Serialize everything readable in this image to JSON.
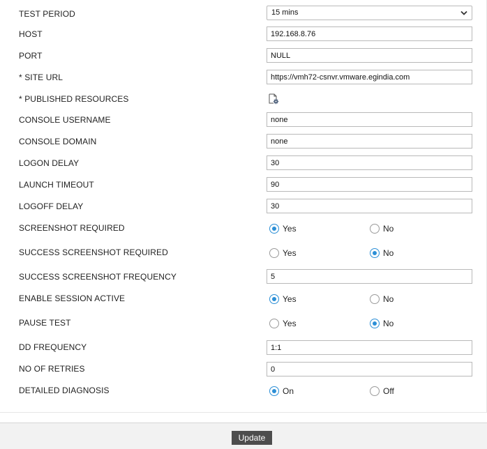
{
  "form": {
    "test_period": {
      "label": "TEST PERIOD",
      "value": "15 mins"
    },
    "host": {
      "label": "HOST",
      "value": "192.168.8.76"
    },
    "port": {
      "label": "PORT",
      "value": "NULL"
    },
    "site_url": {
      "label": "* SITE URL",
      "value": "https://vmh72-csnvr.vmware.egindia.com"
    },
    "published_resources": {
      "label": "* PUBLISHED RESOURCES",
      "icon": "resource-settings-icon"
    },
    "console_username": {
      "label": "CONSOLE USERNAME",
      "value": "none"
    },
    "console_domain": {
      "label": "CONSOLE DOMAIN",
      "value": "none"
    },
    "logon_delay": {
      "label": "LOGON DELAY",
      "value": "30"
    },
    "launch_timeout": {
      "label": "LAUNCH TIMEOUT",
      "value": "90"
    },
    "logoff_delay": {
      "label": "LOGOFF DELAY",
      "value": "30"
    },
    "screenshot_required": {
      "label": "SCREENSHOT REQUIRED",
      "options": [
        "Yes",
        "No"
      ],
      "selected": "Yes"
    },
    "success_screenshot_required": {
      "label": "SUCCESS SCREENSHOT REQUIRED",
      "options": [
        "Yes",
        "No"
      ],
      "selected": "No"
    },
    "success_screenshot_frequency": {
      "label": "SUCCESS SCREENSHOT FREQUENCY",
      "value": "5"
    },
    "enable_session_active": {
      "label": "ENABLE SESSION ACTIVE",
      "options": [
        "Yes",
        "No"
      ],
      "selected": "Yes"
    },
    "pause_test": {
      "label": "PAUSE TEST",
      "options": [
        "Yes",
        "No"
      ],
      "selected": "No"
    },
    "dd_frequency": {
      "label": "DD FREQUENCY",
      "value": "1:1"
    },
    "no_of_retries": {
      "label": "NO OF RETRIES",
      "value": "0"
    },
    "detailed_diagnosis": {
      "label": "DETAILED DIAGNOSIS",
      "options": [
        "On",
        "Off"
      ],
      "selected": "On"
    }
  },
  "footer": {
    "update_label": "Update"
  },
  "colors": {
    "accent": "#2c8fd6",
    "button_bg": "#4d4d4d",
    "footer_bg": "#f2f2f2"
  }
}
